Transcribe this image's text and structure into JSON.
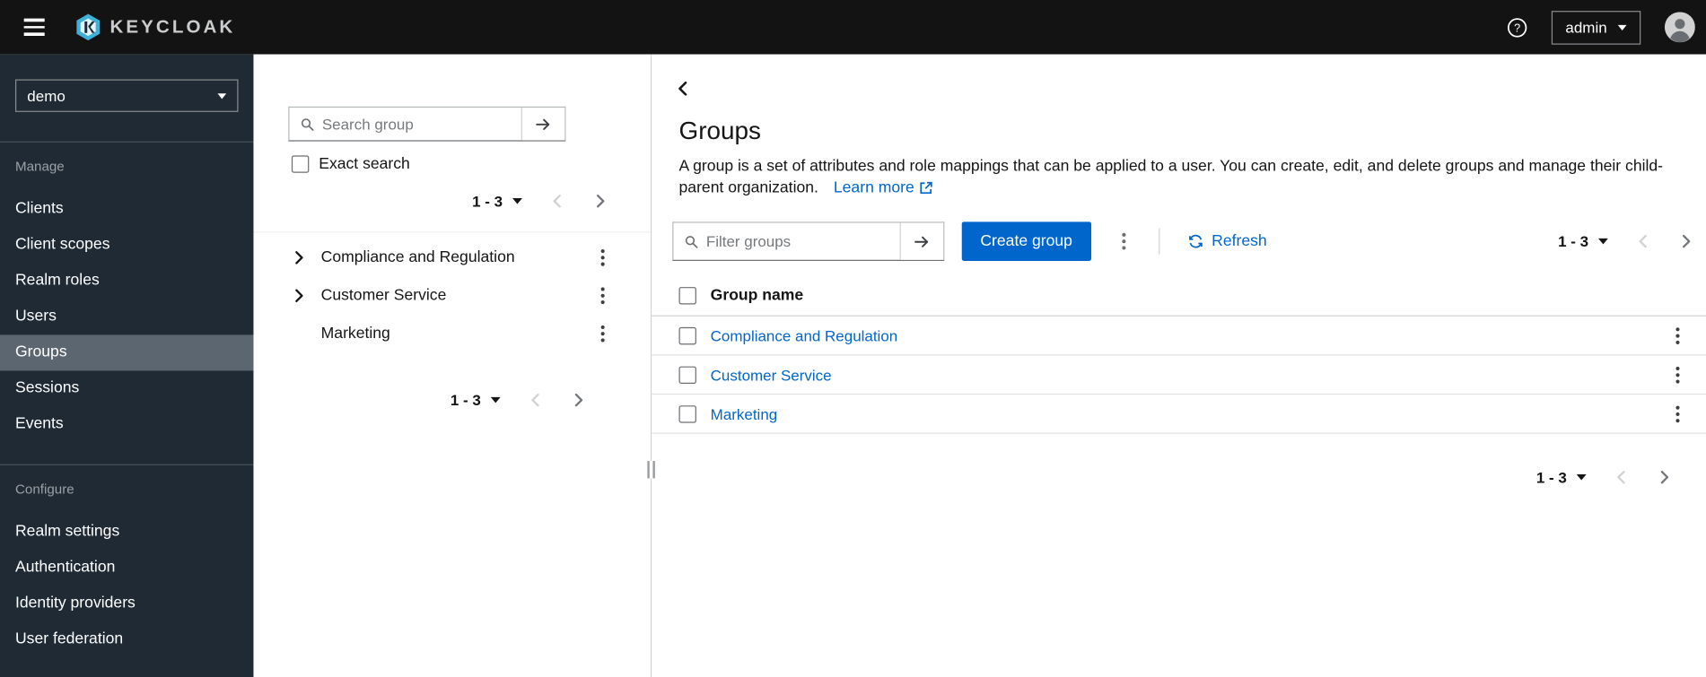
{
  "colors": {
    "accent_blue": "#0066cc",
    "masthead_bg": "#131313",
    "sidebar_bg": "#1f2a35",
    "sidebar_active_bg": "#5c6670",
    "link_blue": "#0066cc",
    "border_gray": "#d2d2d2"
  },
  "header": {
    "brand": "KEYCLOAK",
    "user_label": "admin"
  },
  "sidebar": {
    "realm": "demo",
    "manage": {
      "label": "Manage",
      "items": [
        "Clients",
        "Client scopes",
        "Realm roles",
        "Users",
        "Groups",
        "Sessions",
        "Events"
      ],
      "active_item": "Groups"
    },
    "configure": {
      "label": "Configure",
      "items": [
        "Realm settings",
        "Authentication",
        "Identity providers",
        "User federation"
      ]
    }
  },
  "tree_panel": {
    "search_placeholder": "Search group",
    "exact_search": "Exact search",
    "pagination_range": "1 - 3",
    "items": [
      {
        "label": "Compliance and Regulation",
        "expandable": true
      },
      {
        "label": "Customer Service",
        "expandable": true
      },
      {
        "label": "Marketing",
        "expandable": false
      }
    ],
    "bottom_pagination_range": "1 - 3"
  },
  "main": {
    "title": "Groups",
    "description": "A group is a set of attributes and role mappings that can be applied to a user. You can create, edit, and delete groups and manage their child-parent organization.",
    "learn_more_label": "Learn more",
    "toolbar": {
      "filter_placeholder": "Filter groups",
      "create_label": "Create group",
      "refresh_label": "Refresh",
      "pagination_range": "1 - 3"
    },
    "table": {
      "name_header": "Group name",
      "rows": [
        {
          "name": "Compliance and Regulation"
        },
        {
          "name": "Customer Service"
        },
        {
          "name": "Marketing"
        }
      ]
    },
    "bottom_pagination_range": "1 - 3"
  }
}
